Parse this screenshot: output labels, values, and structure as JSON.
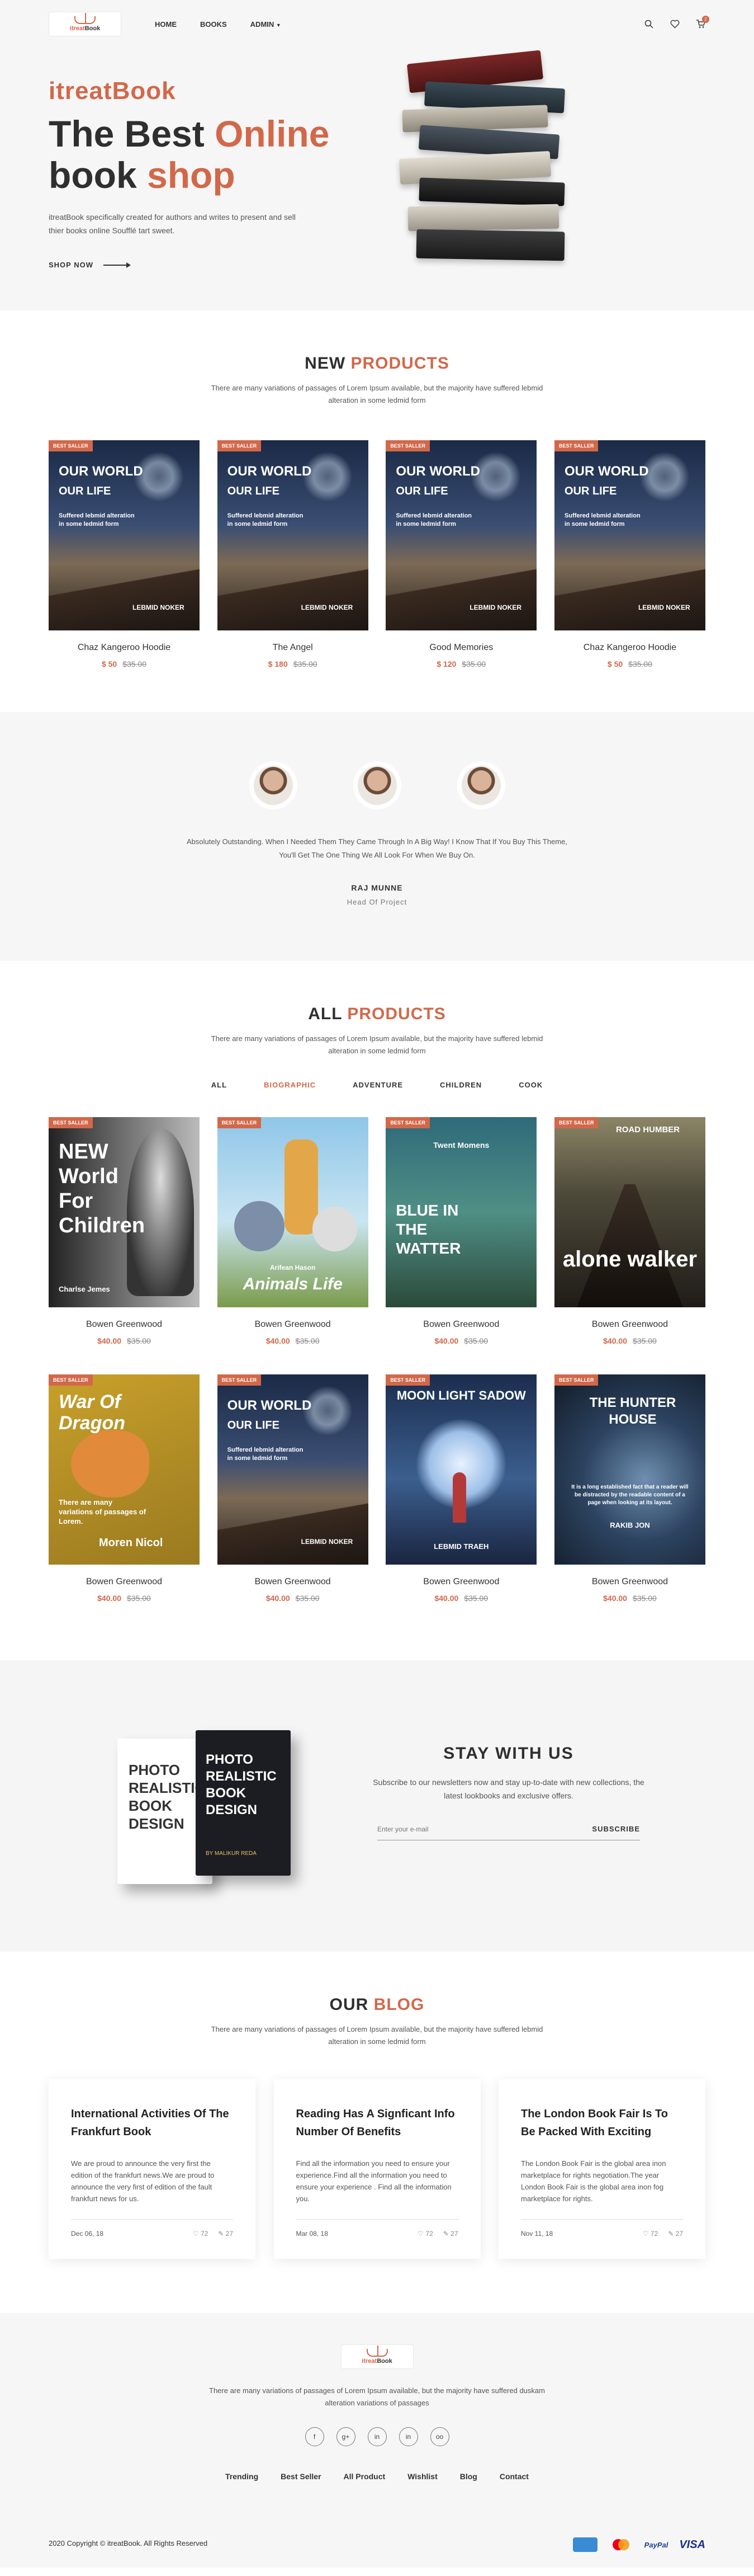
{
  "header": {
    "logo_a": "itreat",
    "logo_b": "Book",
    "nav": [
      "HOME",
      "BOOKS",
      "ADMIN"
    ],
    "cart_count": "2"
  },
  "hero": {
    "subtitle": "itreatBook",
    "title_1": "The Best ",
    "title_2": "Online",
    "title_3": "book ",
    "title_4": "shop",
    "description": "itreatBook specifically created for authors and writes to present and sell thier books online Soufflé tart sweet.",
    "cta": "SHOP NOW"
  },
  "new_products": {
    "title_1": "NEW ",
    "title_2": "PRODUCTS",
    "description": "There are many variations of passages of Lorem Ipsum available, but the majority have suffered lebmid alteration in some ledmid form",
    "items": [
      {
        "tag": "BEST SALLER",
        "c1": "OUR WORLD",
        "c2": "OUR LIFE",
        "c3": "Suffered lebmid alteration in some ledmid form",
        "c4": "LEBMID NOKER",
        "name": "Chaz Kangeroo Hoodie",
        "new_price": "$ 50",
        "old_price": "$35.00"
      },
      {
        "tag": "BEST SALLER",
        "c1": "OUR WORLD",
        "c2": "OUR LIFE",
        "c3": "Suffered lebmid alteration in some ledmid form",
        "c4": "LEBMID NOKER",
        "name": "The Angel",
        "new_price": "$ 180",
        "old_price": "$35.00"
      },
      {
        "tag": "BEST SALLER",
        "c1": "OUR WORLD",
        "c2": "OUR LIFE",
        "c3": "Suffered lebmid alteration in some ledmid form",
        "c4": "LEBMID NOKER",
        "name": "Good Memories",
        "new_price": "$ 120",
        "old_price": "$35.00"
      },
      {
        "tag": "BEST SALLER",
        "c1": "OUR WORLD",
        "c2": "OUR LIFE",
        "c3": "Suffered lebmid alteration in some ledmid form",
        "c4": "LEBMID NOKER",
        "name": "Chaz Kangeroo Hoodie",
        "new_price": "$ 50",
        "old_price": "$35.00"
      }
    ]
  },
  "testimonial": {
    "quote": "Absolutely Outstanding. When I Needed Them They Came Through In A Big Way! I Know That If You Buy This Theme, You'll Get The One Thing We All Look For When We Buy On.",
    "name": "RAJ MUNNE",
    "role": "Head Of Project"
  },
  "all_products": {
    "title_1": "ALL ",
    "title_2": "PRODUCTS",
    "description": "There are many variations of passages of Lorem Ipsum available, but the majority have suffered lebmid alteration in some ledmid form",
    "tabs": [
      "ALL",
      "BIOGRAPHIC",
      "ADVENTURE",
      "CHILDREN",
      "COOK"
    ],
    "items": [
      {
        "tag": "BEST SALLER",
        "c1": "NEW World For Children",
        "c2": "Charlse Jemes",
        "name": "Bowen Greenwood",
        "new_price": "$40.00",
        "old_price": "$35.00"
      },
      {
        "tag": "BEST SALLER",
        "c1": "Arifean Hason",
        "c2": "Animals Life",
        "name": "Bowen Greenwood",
        "new_price": "$40.00",
        "old_price": "$35.00"
      },
      {
        "tag": "BEST SALLER",
        "c1": "Twent Momens",
        "c2": "BLUE IN THE WATTER",
        "name": "Bowen Greenwood",
        "new_price": "$40.00",
        "old_price": "$35.00"
      },
      {
        "tag": "BEST SALLER",
        "c1": "ROAD HUMBER",
        "c2": "alone walker",
        "name": "Bowen Greenwood",
        "new_price": "$40.00",
        "old_price": "$35.00"
      },
      {
        "tag": "BEST SALLER",
        "c1": "War Of Dragon",
        "c2": "There are many variations of passages of Lorem.",
        "c3": "Moren Nicol",
        "name": "Bowen Greenwood",
        "new_price": "$40.00",
        "old_price": "$35.00"
      },
      {
        "tag": "BEST SALLER",
        "c1": "OUR WORLD",
        "c2": "OUR LIFE",
        "c3": "Suffered lebmid alteration in some ledmid form",
        "c4": "LEBMID NOKER",
        "name": "Bowen Greenwood",
        "new_price": "$40.00",
        "old_price": "$35.00"
      },
      {
        "tag": "BEST SALLER",
        "c1": "MOON LIGHT SADOW",
        "c2": "LEBMID TRAEH",
        "name": "Bowen Greenwood",
        "new_price": "$40.00",
        "old_price": "$35.00"
      },
      {
        "tag": "BEST SALLER",
        "c1": "THE HUNTER HOUSE",
        "c2": "It is a long established fact that a reader will be distracted by the readable content of a page when looking at its layout.",
        "c3": "RAKIB JON",
        "name": "Bowen Greenwood",
        "new_price": "$40.00",
        "old_price": "$35.00"
      }
    ]
  },
  "newsletter": {
    "book_title": "PHOTO REALISTIC BOOK DESIGN",
    "book_author": "BY MALIKUR REDA",
    "title": "STAY WITH US",
    "description": "Subscribe to our newsletters now and stay up-to-date with new collections, the latest lookbooks and exclusive offers.",
    "placeholder": "Enter your e-mail",
    "button": "SUBSCRIBE"
  },
  "blog": {
    "title_1": "OUR ",
    "title_2": "BLOG",
    "description": "There are many variations of passages of Lorem Ipsum available, but the majority have suffered lebmid alteration in some ledmid form",
    "posts": [
      {
        "title": "International Activities Of The Frankfurt Book",
        "excerpt": "We are proud to announce the very first the edition of the frankfurt news.We are proud to announce the very first of edition of the fault frankfurt news for us.",
        "date": "Dec 06, 18",
        "likes": "72",
        "comments": "27"
      },
      {
        "title": "Reading Has A Signficant Info Number Of Benefits",
        "excerpt": "Find all the information you need to ensure your experience.Find all the information you need to ensure your experience . Find all the information you.",
        "date": "Mar 08, 18",
        "likes": "72",
        "comments": "27"
      },
      {
        "title": "The London Book Fair Is To Be Packed With Exciting",
        "excerpt": "The London Book Fair is the global area inon marketplace for rights negotiation.The year London Book Fair is the global area inon fog marketplace for rights.",
        "date": "Nov 11, 18",
        "likes": "72",
        "comments": "27"
      }
    ]
  },
  "footer": {
    "description": "There are many variations of passages of Lorem Ipsum available, but the majority have suffered duskam alteration variations of passages",
    "links": [
      "Trending",
      "Best Seller",
      "All Product",
      "Wishlist",
      "Blog",
      "Contact"
    ],
    "social": [
      "f",
      "g+",
      "in",
      "in",
      "oo"
    ],
    "copyright": "2020 Copyright © itreatBook. All Rights Reserved",
    "payments": [
      "citrus",
      "mastercard",
      "PayPal",
      "VISA"
    ]
  },
  "colors": {
    "accent": "#d2684a",
    "dark": "#2f2f2f"
  }
}
